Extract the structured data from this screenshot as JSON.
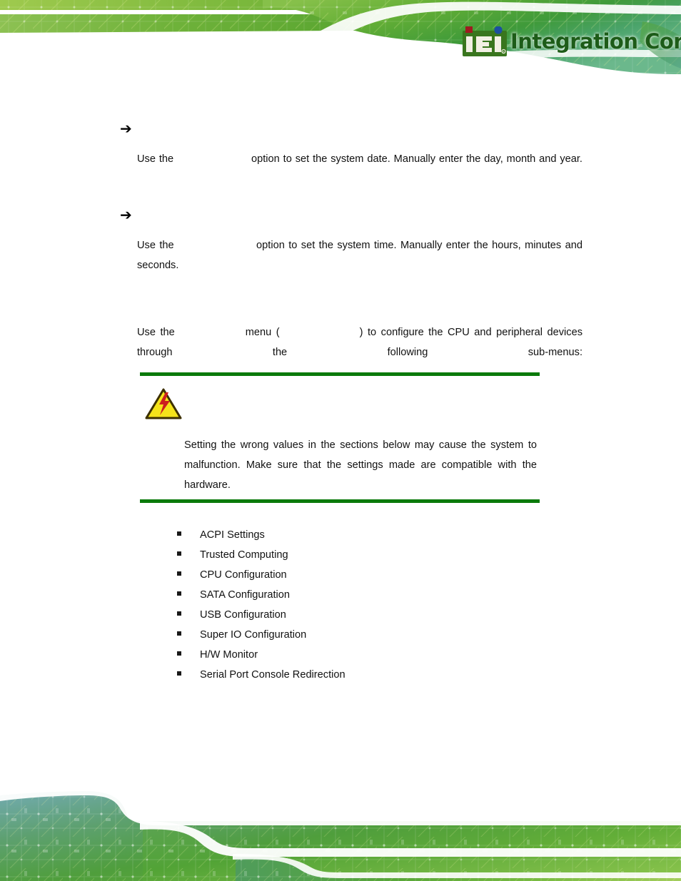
{
  "document": {
    "page_background": "#ffffff",
    "accent_green": "#0a7a0a",
    "brand_green": "#1d5c18"
  },
  "header": {
    "logo": {
      "mark_text_left": "iE",
      "mark_text_right": "i",
      "registered_mark": "®",
      "company_name": "Integration Corp.",
      "square_accent_color": "#9e1b20",
      "dot_accent_color": "#1c4fa0",
      "mark_background": "#3f7d22"
    }
  },
  "sections": [
    {
      "name": "system-date",
      "arrow_glyph": "➔",
      "title": "",
      "paragraph_prefix": "Use the ",
      "reference": "",
      "paragraph_suffix": "option to set the system date. Manually enter the day, month and year."
    },
    {
      "name": "system-time",
      "arrow_glyph": "➔",
      "title": "",
      "paragraph_prefix": "Use the ",
      "reference": "",
      "paragraph_suffix": "option to set the system time. Manually enter the hours, minutes and seconds."
    }
  ],
  "advanced": {
    "heading": "",
    "intro_part1": "Use the ",
    "intro_menu_ref": "",
    "intro_part2": " menu (",
    "intro_figure_ref": "",
    "intro_part3": ") to configure the CPU and peripheral devices through the following sub-menus:"
  },
  "warning": {
    "icon": "warning-triangle-icon",
    "icon_fill": "#f5e41a",
    "icon_border": "#3d3000",
    "bolt_color": "#cc1f1f",
    "label": "",
    "text": "Setting the wrong values in the sections below may cause the system to malfunction. Make sure that the settings made are compatible with the hardware.",
    "rule_color": "#0a7a0a"
  },
  "submenus": {
    "bullet_glyph": "▪",
    "items": [
      "ACPI Settings",
      "Trusted Computing",
      "CPU Configuration",
      "SATA Configuration",
      "USB Configuration",
      "Super IO Configuration",
      "H/W Monitor",
      "Serial Port Console Redirection"
    ]
  }
}
